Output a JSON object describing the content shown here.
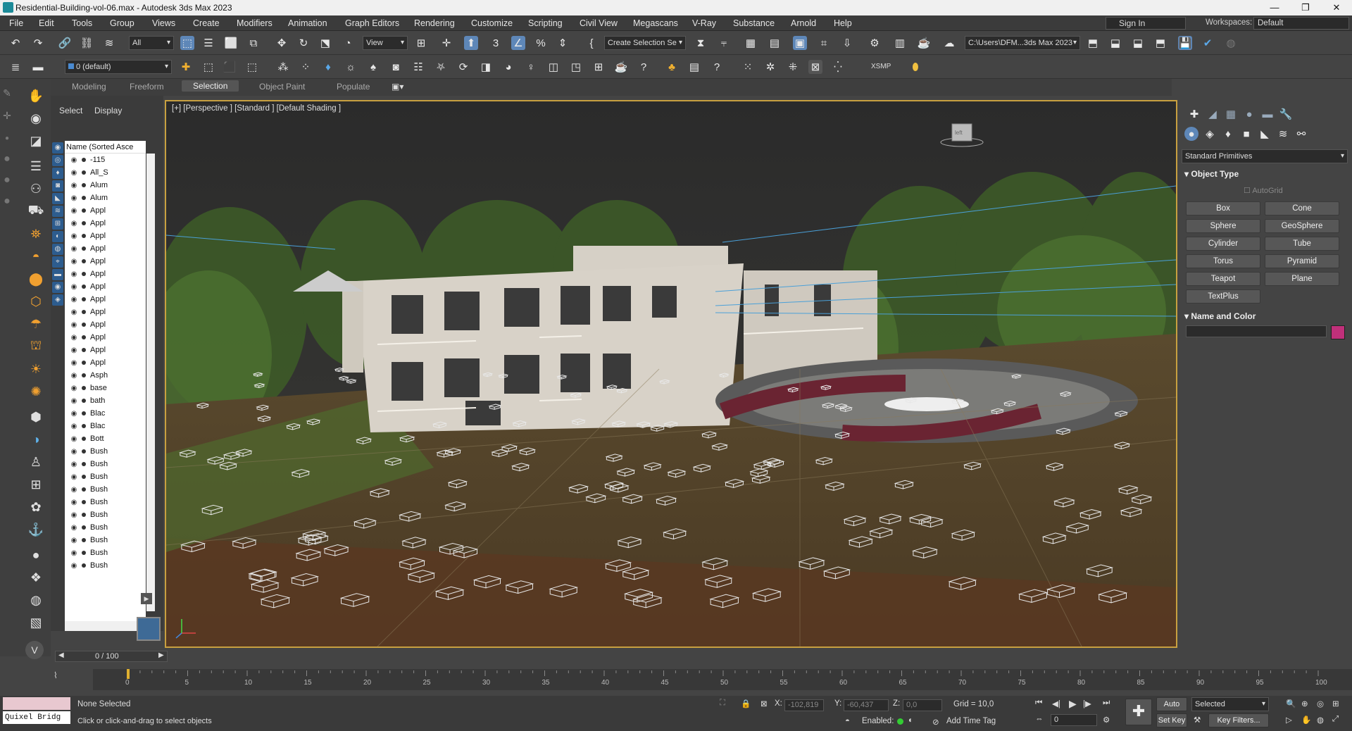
{
  "window": {
    "title": "Residential-Building-vol-06.max - Autodesk 3ds Max 2023",
    "min": "—",
    "max": "❐",
    "close": "✕"
  },
  "menu": [
    "File",
    "Edit",
    "Tools",
    "Group",
    "Views",
    "Create",
    "Modifiers",
    "Animation",
    "Graph Editors",
    "Rendering",
    "Customize",
    "Scripting",
    "Civil View",
    "Megascans",
    "V-Ray",
    "Substance",
    "Arnold",
    "Help"
  ],
  "account": {
    "signin": "Sign In",
    "workspaces_label": "Workspaces:",
    "workspace": "Default"
  },
  "toolbar1": {
    "filter": "All",
    "refcoord": "View",
    "selection_set": "Create Selection Se",
    "path": "C:\\Users\\DFM...3ds Max 2023"
  },
  "toolbar2": {
    "layer": "0 (default)",
    "xsmp": "XSMP"
  },
  "ribbon": {
    "tabs": [
      "Modeling",
      "Freeform",
      "Selection",
      "Object Paint",
      "Populate"
    ],
    "active": "Selection"
  },
  "scene_explorer": {
    "tab_select": "Select",
    "tab_display": "Display",
    "column": "Name (Sorted Asce",
    "items": [
      "-115",
      "All_S",
      "Alum",
      "Alum",
      "Appl",
      "Appl",
      "Appl",
      "Appl",
      "Appl",
      "Appl",
      "Appl",
      "Appl",
      "Appl",
      "Appl",
      "Appl",
      "Appl",
      "Appl",
      "Asph",
      "base",
      "bath",
      "Blac",
      "Blac",
      "Bott",
      "Bush",
      "Bush",
      "Bush",
      "Bush",
      "Bush",
      "Bush",
      "Bush",
      "Bush",
      "Bush",
      "Bush"
    ]
  },
  "viewport": {
    "label": "[+] [Perspective ] [Standard ] [Default Shading ]",
    "viewcube": "left"
  },
  "command_panel": {
    "category": "Standard Primitives",
    "object_type": "Object Type",
    "autogrid": "AutoGrid",
    "buttons": [
      "Box",
      "Cone",
      "Sphere",
      "GeoSphere",
      "Cylinder",
      "Tube",
      "Torus",
      "Pyramid",
      "Teapot",
      "Plane",
      "TextPlus"
    ],
    "name_color": "Name and Color",
    "color": "#c0307a"
  },
  "timeline": {
    "frame": "0 / 100",
    "ticks": [
      "0",
      "5",
      "10",
      "15",
      "20",
      "25",
      "30",
      "35",
      "40",
      "45",
      "50",
      "55",
      "60",
      "65",
      "70",
      "75",
      "80",
      "85",
      "90",
      "95",
      "100"
    ]
  },
  "status": {
    "quixel": "Quixel Bridg",
    "selection": "None Selected",
    "prompt": "Click or click-and-drag to select objects",
    "x_label": "X:",
    "x": "-102,819",
    "y_label": "Y:",
    "y": "-60,437",
    "z_label": "Z:",
    "z": "0,0",
    "grid": "Grid = 10,0",
    "enabled": "Enabled:",
    "add_time_tag": "Add Time Tag",
    "auto_key": "Auto Key",
    "set_key": "Set Key",
    "key_mode": "Selected",
    "key_filters": "Key Filters...",
    "frame_field": "0"
  }
}
